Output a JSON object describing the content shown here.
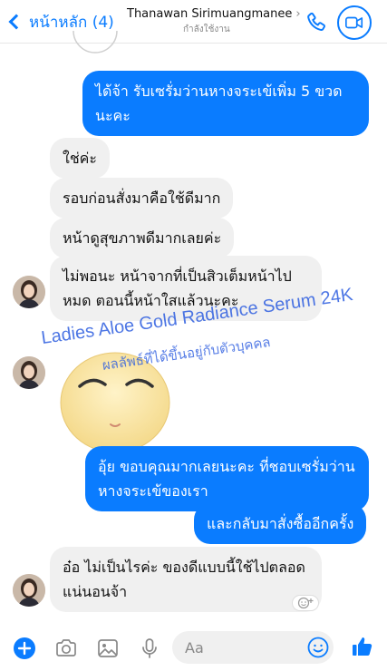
{
  "header": {
    "back_label": "หน้าหลัก (4)",
    "contact_name": "Thanawan Sirimuangmanee",
    "contact_status": "กำลังใช้งาน"
  },
  "messages": [
    {
      "id": "m1",
      "from": "me",
      "text": "ได้จ้า รับเซรั่มว่านหางจระเข้เพิ่ม 5 ขวดนะคะ"
    },
    {
      "id": "m2",
      "from": "them",
      "text": "ใช่ค่ะ"
    },
    {
      "id": "m3",
      "from": "them",
      "text": "รอบก่อนสั่งมาคือใช้ดีมาก"
    },
    {
      "id": "m4",
      "from": "them",
      "text": "หน้าดูสุขภาพดีมากเลยค่ะ"
    },
    {
      "id": "m5",
      "from": "them",
      "text": "ไม่พอนะ หน้าจากที่เป็นสิวเต็มหน้าไปหมด ตอนนี้หน้าใสแล้วนะคะ"
    },
    {
      "id": "m6",
      "from": "them",
      "text": "sticker"
    },
    {
      "id": "m7",
      "from": "me",
      "text": "อุ้ย ขอบคุณมากเลยนะคะ ที่ชอบเซรั่มว่านหางจระเข้ของเรา"
    },
    {
      "id": "m8",
      "from": "me",
      "text": "และกลับมาสั่งซื้ออีกครั้ง"
    },
    {
      "id": "m9",
      "from": "them",
      "text": "อ๋อ ไม่เป็นไรค่ะ ของดีแบบนี้ใช้ไปตลอดแน่นอนจ้า"
    }
  ],
  "watermark": {
    "product": "Ladies Aloe Gold Radiance Serum 24K",
    "disclaimer": "ผลลัพธ์ที่ได้ขึ้นอยู่กับตัวบุคคล"
  },
  "composer": {
    "placeholder": "Aa"
  },
  "colors": {
    "accent": "#0a7cff",
    "incoming_bubble": "#f0f0f0",
    "watermark": "#2f5fe0"
  },
  "icons": [
    "chevron-left-icon",
    "phone-icon",
    "video-icon",
    "plus-icon",
    "camera-icon",
    "image-icon",
    "microphone-icon",
    "smiley-icon",
    "like-icon",
    "sticker-emoji",
    "add-reaction-icon"
  ]
}
